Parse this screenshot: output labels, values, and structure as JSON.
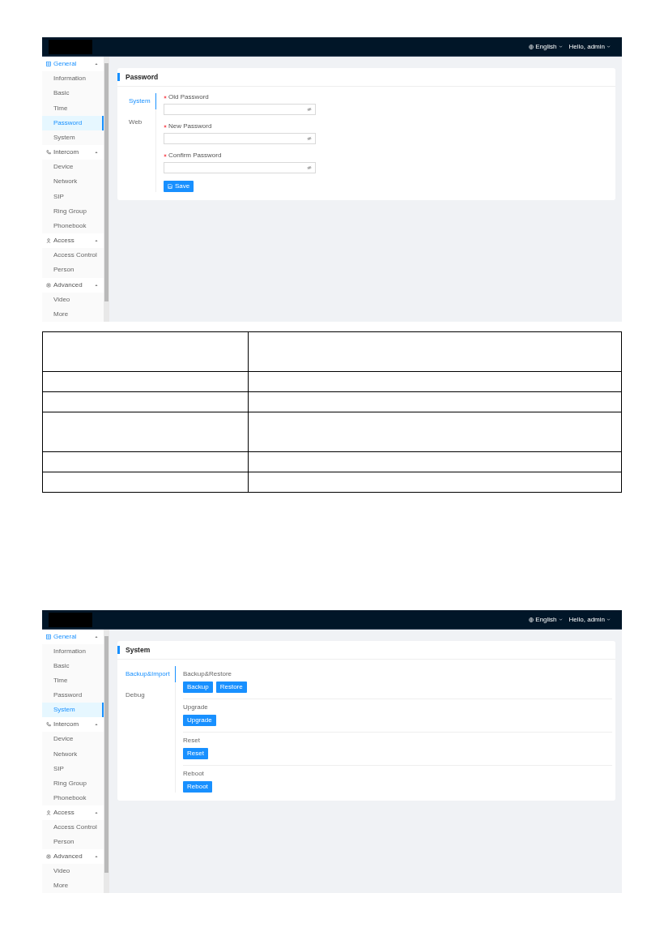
{
  "pages": [
    {
      "header": {
        "language": "English",
        "user": "Hello, admin"
      },
      "sidebar": [
        {
          "label": "General",
          "kind": "grid",
          "expanded": true,
          "items": [
            {
              "label": "Information",
              "selected": false
            },
            {
              "label": "Basic",
              "selected": false
            },
            {
              "label": "Time",
              "selected": false
            },
            {
              "label": "Password",
              "selected": true
            },
            {
              "label": "System",
              "selected": false
            }
          ]
        },
        {
          "label": "Intercom",
          "kind": "phone",
          "expanded": true,
          "items": [
            {
              "label": "Device",
              "selected": false
            },
            {
              "label": "Network",
              "selected": false
            },
            {
              "label": "SIP",
              "selected": false
            },
            {
              "label": "Ring Group",
              "selected": false
            },
            {
              "label": "Phonebook",
              "selected": false
            }
          ]
        },
        {
          "label": "Access",
          "kind": "person",
          "expanded": true,
          "items": [
            {
              "label": "Access Control",
              "selected": false
            },
            {
              "label": "Person",
              "selected": false
            }
          ]
        },
        {
          "label": "Advanced",
          "kind": "gear",
          "expanded": true,
          "items": [
            {
              "label": "Video",
              "selected": false
            },
            {
              "label": "More",
              "selected": false
            }
          ]
        }
      ],
      "panel": {
        "kind": "password",
        "title": "Password",
        "tabs": [
          {
            "label": "System",
            "selected": true
          },
          {
            "label": "Web",
            "selected": false
          }
        ],
        "fields": [
          {
            "label": "Old Password",
            "required": true
          },
          {
            "label": "New Password",
            "required": true
          },
          {
            "label": "Confirm Password",
            "required": true
          }
        ],
        "save_button": "Save"
      }
    },
    {
      "header": {
        "language": "English",
        "user": "Hello, admin"
      },
      "sidebar": [
        {
          "label": "General",
          "kind": "grid",
          "expanded": true,
          "items": [
            {
              "label": "Information",
              "selected": false
            },
            {
              "label": "Basic",
              "selected": false
            },
            {
              "label": "Time",
              "selected": false
            },
            {
              "label": "Password",
              "selected": false
            },
            {
              "label": "System",
              "selected": true
            }
          ]
        },
        {
          "label": "Intercom",
          "kind": "phone",
          "expanded": true,
          "items": [
            {
              "label": "Device",
              "selected": false
            },
            {
              "label": "Network",
              "selected": false
            },
            {
              "label": "SIP",
              "selected": false
            },
            {
              "label": "Ring Group",
              "selected": false
            },
            {
              "label": "Phonebook",
              "selected": false
            }
          ]
        },
        {
          "label": "Access",
          "kind": "person",
          "expanded": true,
          "items": [
            {
              "label": "Access Control",
              "selected": false
            },
            {
              "label": "Person",
              "selected": false
            }
          ]
        },
        {
          "label": "Advanced",
          "kind": "gear",
          "expanded": true,
          "items": [
            {
              "label": "Video",
              "selected": false
            },
            {
              "label": "More",
              "selected": false
            }
          ]
        }
      ],
      "panel": {
        "kind": "system",
        "title": "System",
        "tabs": [
          {
            "label": "Backup&Import",
            "selected": true
          },
          {
            "label": "Debug",
            "selected": false
          }
        ],
        "sections": [
          {
            "label": "Backup&Restore",
            "buttons": [
              "Backup",
              "Restore"
            ]
          },
          {
            "label": "Upgrade",
            "buttons": [
              "Upgrade"
            ]
          },
          {
            "label": "Reset",
            "buttons": [
              "Reset"
            ]
          },
          {
            "label": "Reboot",
            "buttons": [
              "Reboot"
            ]
          }
        ]
      }
    }
  ],
  "doc_table": {
    "rows": [
      {
        "kind": "tall"
      },
      {
        "kind": "short"
      },
      {
        "kind": "short"
      },
      {
        "kind": "tall"
      },
      {
        "kind": "short"
      },
      {
        "kind": "short"
      }
    ]
  }
}
